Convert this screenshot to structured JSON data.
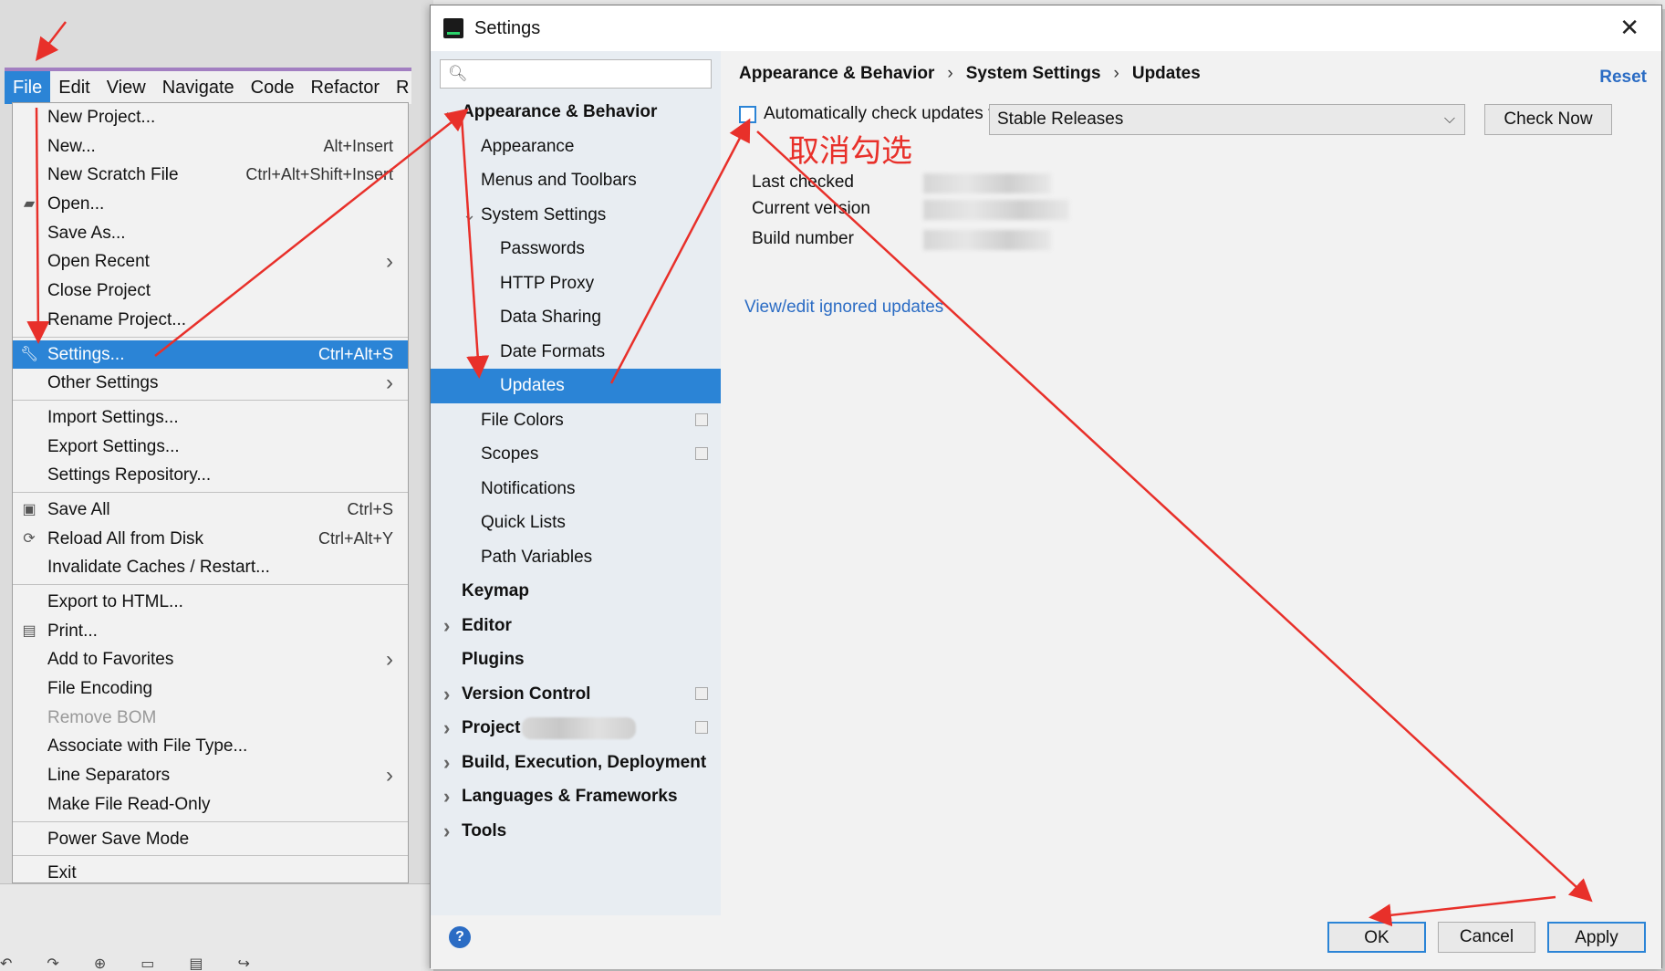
{
  "menubar": {
    "items": [
      "File",
      "Edit",
      "View",
      "Navigate",
      "Code",
      "Refactor",
      "R"
    ]
  },
  "file_menu": {
    "items": [
      {
        "label": "New Project...",
        "shortcut": ""
      },
      {
        "label": "New...",
        "shortcut": "Alt+Insert"
      },
      {
        "label": "New Scratch File",
        "shortcut": "Ctrl+Alt+Shift+Insert"
      },
      {
        "label": "Open...",
        "shortcut": "",
        "icon": "folder-icon"
      },
      {
        "label": "Save As...",
        "shortcut": ""
      },
      {
        "label": "Open Recent",
        "shortcut": "",
        "submenu": true
      },
      {
        "label": "Close Project",
        "shortcut": ""
      },
      {
        "label": "Rename Project...",
        "shortcut": ""
      },
      {
        "sep": true
      },
      {
        "label": "Settings...",
        "shortcut": "Ctrl+Alt+S",
        "selected": true,
        "icon": "wrench-icon"
      },
      {
        "label": "Other Settings",
        "shortcut": "",
        "submenu": true
      },
      {
        "sep": true
      },
      {
        "label": "Import Settings...",
        "shortcut": ""
      },
      {
        "label": "Export Settings...",
        "shortcut": ""
      },
      {
        "label": "Settings Repository...",
        "shortcut": ""
      },
      {
        "sep": true
      },
      {
        "label": "Save All",
        "shortcut": "Ctrl+S",
        "icon": "save-icon"
      },
      {
        "label": "Reload All from Disk",
        "shortcut": "Ctrl+Alt+Y",
        "icon": "reload-icon"
      },
      {
        "label": "Invalidate Caches / Restart...",
        "shortcut": ""
      },
      {
        "sep": true
      },
      {
        "label": "Export to HTML...",
        "shortcut": ""
      },
      {
        "label": "Print...",
        "shortcut": "",
        "icon": "printer-icon"
      },
      {
        "label": "Add to Favorites",
        "shortcut": "",
        "submenu": true
      },
      {
        "label": "File Encoding",
        "shortcut": ""
      },
      {
        "label": "Remove BOM",
        "shortcut": "",
        "disabled": true
      },
      {
        "label": "Associate with File Type...",
        "shortcut": ""
      },
      {
        "label": "Line Separators",
        "shortcut": "",
        "submenu": true
      },
      {
        "label": "Make File Read-Only",
        "shortcut": ""
      },
      {
        "sep": true
      },
      {
        "label": "Power Save Mode",
        "shortcut": ""
      },
      {
        "sep": true
      },
      {
        "label": "Exit",
        "shortcut": ""
      }
    ]
  },
  "dialog": {
    "title": "Settings",
    "search_placeholder": "",
    "tree": [
      {
        "label": "Appearance & Behavior",
        "level": 0,
        "bold": true,
        "expanded": true
      },
      {
        "label": "Appearance",
        "level": 1
      },
      {
        "label": "Menus and Toolbars",
        "level": 1
      },
      {
        "label": "System Settings",
        "level": 1,
        "expanded": true
      },
      {
        "label": "Passwords",
        "level": 2
      },
      {
        "label": "HTTP Proxy",
        "level": 2
      },
      {
        "label": "Data Sharing",
        "level": 2
      },
      {
        "label": "Date Formats",
        "level": 2
      },
      {
        "label": "Updates",
        "level": 2,
        "selected": true
      },
      {
        "label": "File Colors",
        "level": 1,
        "copy": true
      },
      {
        "label": "Scopes",
        "level": 1,
        "copy": true
      },
      {
        "label": "Notifications",
        "level": 1
      },
      {
        "label": "Quick Lists",
        "level": 1
      },
      {
        "label": "Path Variables",
        "level": 1
      },
      {
        "label": "Keymap",
        "level": 0,
        "bold": true
      },
      {
        "label": "Editor",
        "level": 0,
        "bold": true,
        "collapsed": true
      },
      {
        "label": "Plugins",
        "level": 0,
        "bold": true
      },
      {
        "label": "Version Control",
        "level": 0,
        "bold": true,
        "collapsed": true,
        "copy": true
      },
      {
        "label": "Project",
        "level": 0,
        "bold": true,
        "collapsed": true,
        "copy": true,
        "blurred_suffix": true
      },
      {
        "label": "Build, Execution, Deployment",
        "level": 0,
        "bold": true,
        "collapsed": true
      },
      {
        "label": "Languages & Frameworks",
        "level": 0,
        "bold": true,
        "collapsed": true
      },
      {
        "label": "Tools",
        "level": 0,
        "bold": true,
        "collapsed": true
      }
    ],
    "breadcrumb": [
      "Appearance & Behavior",
      "System Settings",
      "Updates"
    ],
    "reset_label": "Reset",
    "auto_check_label": "Automatically check updates for",
    "auto_check_checked": false,
    "channel_selected": "Stable Releases",
    "check_now_label": "Check Now",
    "annotation_text": "取消勾选",
    "info": {
      "last_checked_label": "Last checked",
      "current_version_label": "Current version",
      "build_number_label": "Build number"
    },
    "ignored_link": "View/edit ignored updates",
    "footer": {
      "help": "?",
      "ok": "OK",
      "cancel": "Cancel",
      "apply": "Apply"
    }
  },
  "colors": {
    "selection": "#2b84d6",
    "annotation": "#e8302a",
    "link": "#2b6cc4"
  }
}
